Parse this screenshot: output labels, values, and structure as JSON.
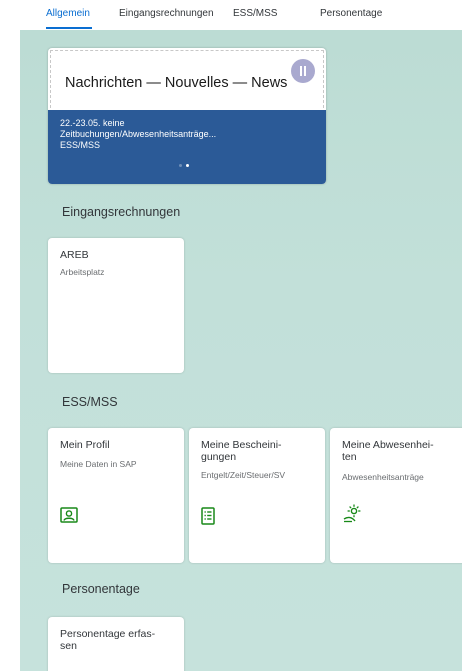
{
  "tabs": [
    {
      "label": "Allgemein",
      "active": true
    },
    {
      "label": "Eingangsrechnungen",
      "active": false
    },
    {
      "label": "ESS/MSS",
      "active": false
    },
    {
      "label": "Personentage",
      "active": false
    }
  ],
  "news": {
    "heading": "Nachrichten — Nouvelles — News",
    "item_date": "22.-23.05. keine",
    "item_text": "Zeitbuchungen/Abwesenheitsanträge...",
    "item_source": "ESS/MSS",
    "pause_icon": "pause-icon",
    "band_color": "#2b5a97"
  },
  "sections": {
    "eingangsrechnungen": {
      "title": "Eingangsrechnungen",
      "tiles": [
        {
          "title": "AREB",
          "subtitle": "Arbeitsplatz"
        }
      ]
    },
    "ess_mss": {
      "title": "ESS/MSS",
      "tiles": [
        {
          "title": "Mein Profil",
          "subtitle": "Meine Daten in SAP",
          "icon": "person-card-icon"
        },
        {
          "title_line1": "Meine Bescheini-",
          "title_line2": "gungen",
          "subtitle": "Entgelt/Zeit/Steuer/SV",
          "icon": "document-list-icon"
        },
        {
          "title_line1": "Meine Abwesenhei-",
          "title_line2": "ten",
          "subtitle": "Abwesenheitsanträge",
          "icon": "sun-vacation-icon"
        }
      ]
    },
    "personentage": {
      "title": "Personentage",
      "tiles": [
        {
          "title_line1": "Personentage erfas-",
          "title_line2": "sen"
        }
      ]
    }
  },
  "colors": {
    "accent": "#0a6ed1",
    "icon_green": "#188918",
    "canvas_bg": "#bfdfd7"
  }
}
